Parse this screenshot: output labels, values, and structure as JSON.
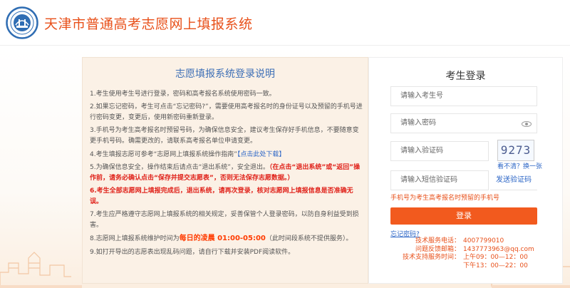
{
  "header": {
    "site_title": "天津市普通高考志愿网上填报系统",
    "logo_icon": "tianjin-exam-logo"
  },
  "notice": {
    "title": "志愿填报系统登录说明",
    "items": [
      "1.考生使用考生号进行登录，密码和高考报名系统使用密码一致。",
      "2.如果忘记密码，考生可点击“忘记密码?”，需要使用高考报名时的身份证号以及预留的手机号进行密码变更，变更后，使用新密码重新登录。",
      "3.手机号为考生高考报名时预留号码，为确保信息安全，建议考生保存好手机信息，不要随意变更手机号码。确需更改的，请联系高考报名单位申请变更。",
      "4.考生填报志愿可参考“志愿网上填报系统操作指南”",
      "【点击此处下载】",
      "5.为确保信息安全，操作结束后请点击“退出系统”，安全退出。",
      "（在点击“退出系统”或“返回”操作前，请务必确认点击“保存并提交志愿表”，否则无法保存志愿数据。）",
      "6.考生全部志愿网上填报完成后，退出系统，请再次登录，核对志愿网上填报信息是否准确无误。",
      "7.考生应严格遵守志愿网上填报系统的相关规定，妥善保管个人登录密码，以防自身利益受到损害。",
      "8.志愿网上填报系统维护时间为",
      "每日的凌晨 01:00-05:00",
      "（此时间段系统不提供服务）。",
      "9.如打开导出的志愿表出现乱码问题，请自行下载并安装PDF阅读软件。"
    ]
  },
  "login": {
    "title": "考生登录",
    "username_placeholder": "请输入考生号",
    "password_placeholder": "请输入密码",
    "captcha_placeholder": "请输入验证码",
    "captcha_text": "9273",
    "captcha_refresh": "看不清？换一张",
    "sms_placeholder": "请输入短信验证码",
    "send_code": "发送验证码",
    "phone_hint": "手机号为考生高考报名时预留的手机号",
    "login_button": "登录",
    "forgot_password": "忘记密码?",
    "support": {
      "phone_label": "技术服务电话：",
      "phone": "4007799010",
      "email_label": "问题反馈邮箱：",
      "email": "1437773963@qq.com",
      "hours_label": "技术支持服务时间：",
      "hours_am": "上午09：00—12：00",
      "hours_pm": "下午13：00—22：00"
    }
  },
  "colors": {
    "brand": "#e8501a",
    "link": "#2b65c6",
    "button": "#f25a1e",
    "title_blue": "#3d6fb6"
  }
}
